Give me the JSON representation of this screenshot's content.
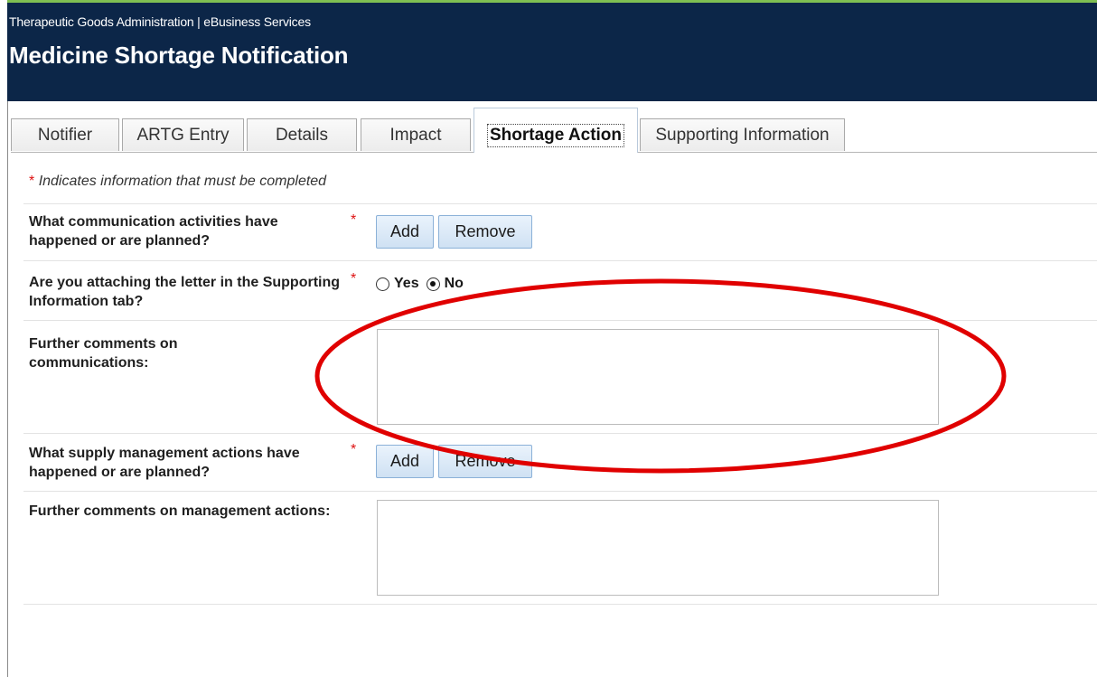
{
  "header": {
    "org": "Therapeutic Goods Administration | eBusiness Services",
    "title": "Medicine Shortage Notification"
  },
  "tabs": [
    {
      "label": "Notifier"
    },
    {
      "label": "ARTG Entry"
    },
    {
      "label": "Details"
    },
    {
      "label": "Impact"
    },
    {
      "label": "Shortage Action"
    },
    {
      "label": "Supporting Information"
    }
  ],
  "active_tab": "Shortage Action",
  "form": {
    "required_hint": "Indicates information that must be completed",
    "required_mark": "*",
    "communication_activities": {
      "label": "What communication activities have happened or are planned?",
      "add": "Add",
      "remove": "Remove"
    },
    "attaching_letter": {
      "label": "Are you attaching the letter in the Supporting Information tab?",
      "options": [
        "Yes",
        "No"
      ],
      "selected": "No"
    },
    "comments_communications": {
      "label": "Further comments on communications:",
      "value": ""
    },
    "supply_management": {
      "label": "What supply management actions have happened or are planned?",
      "add": "Add",
      "remove": "Remove"
    },
    "comments_management": {
      "label": "Further comments on management actions:",
      "value": ""
    }
  },
  "colors": {
    "header_bg": "#0c2648",
    "required": "#dd1111",
    "annotation": "#e00000"
  }
}
